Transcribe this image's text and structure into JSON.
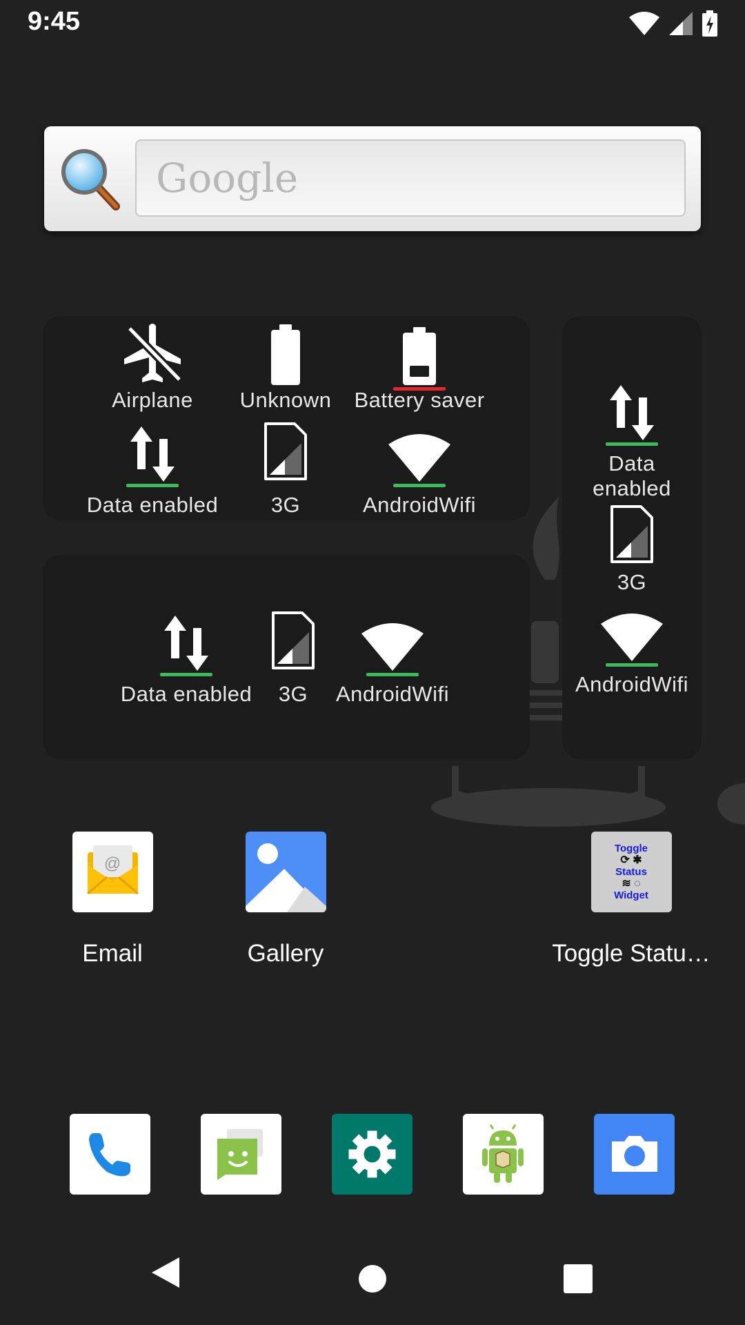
{
  "status_bar": {
    "time": "9:45"
  },
  "search_widget": {
    "placeholder": "Google"
  },
  "widget_main": {
    "row1": [
      {
        "label": "Airplane",
        "icon": "airplane-off-icon"
      },
      {
        "label": "Unknown",
        "icon": "battery-full-icon"
      },
      {
        "label": "Battery saver",
        "icon": "battery-low-icon",
        "indicator": "#e02a2a"
      }
    ],
    "row2": [
      {
        "label": "Data enabled",
        "icon": "data-arrows-icon",
        "indicator": "#3cb95a"
      },
      {
        "label": "3G",
        "icon": "sim-signal-icon"
      },
      {
        "label": "AndroidWifi",
        "icon": "wifi-icon",
        "indicator": "#3cb95a"
      }
    ]
  },
  "widget_small": {
    "items": [
      {
        "label": "Data enabled",
        "icon": "data-arrows-icon"
      },
      {
        "label": "3G",
        "icon": "sim-signal-icon"
      },
      {
        "label": "AndroidWifi",
        "icon": "wifi-icon"
      }
    ]
  },
  "widget_vertical": {
    "items": [
      {
        "label_line1": "Data",
        "label_line2": "enabled",
        "icon": "data-arrows-icon"
      },
      {
        "label": "3G",
        "icon": "sim-signal-icon"
      },
      {
        "label": "AndroidWifi",
        "icon": "wifi-icon"
      }
    ]
  },
  "apps": [
    {
      "name": "Email",
      "icon": "email-app-icon"
    },
    {
      "name": "Gallery",
      "icon": "gallery-app-icon"
    },
    {
      "name": "Toggle Statu…",
      "icon": "toggle-status-widget-app-icon",
      "tile_text": [
        "Toggle",
        "Status",
        "Widget"
      ]
    }
  ],
  "dock": [
    {
      "icon": "phone-app-icon"
    },
    {
      "icon": "messaging-app-icon"
    },
    {
      "icon": "settings-app-icon"
    },
    {
      "icon": "android-app-icon"
    },
    {
      "icon": "camera-app-icon"
    }
  ],
  "nav": [
    "back-button",
    "home-button",
    "recents-button"
  ],
  "colors": {
    "green_indicator": "#3cb95a",
    "red_indicator": "#e02a2a",
    "background": "#212122"
  }
}
